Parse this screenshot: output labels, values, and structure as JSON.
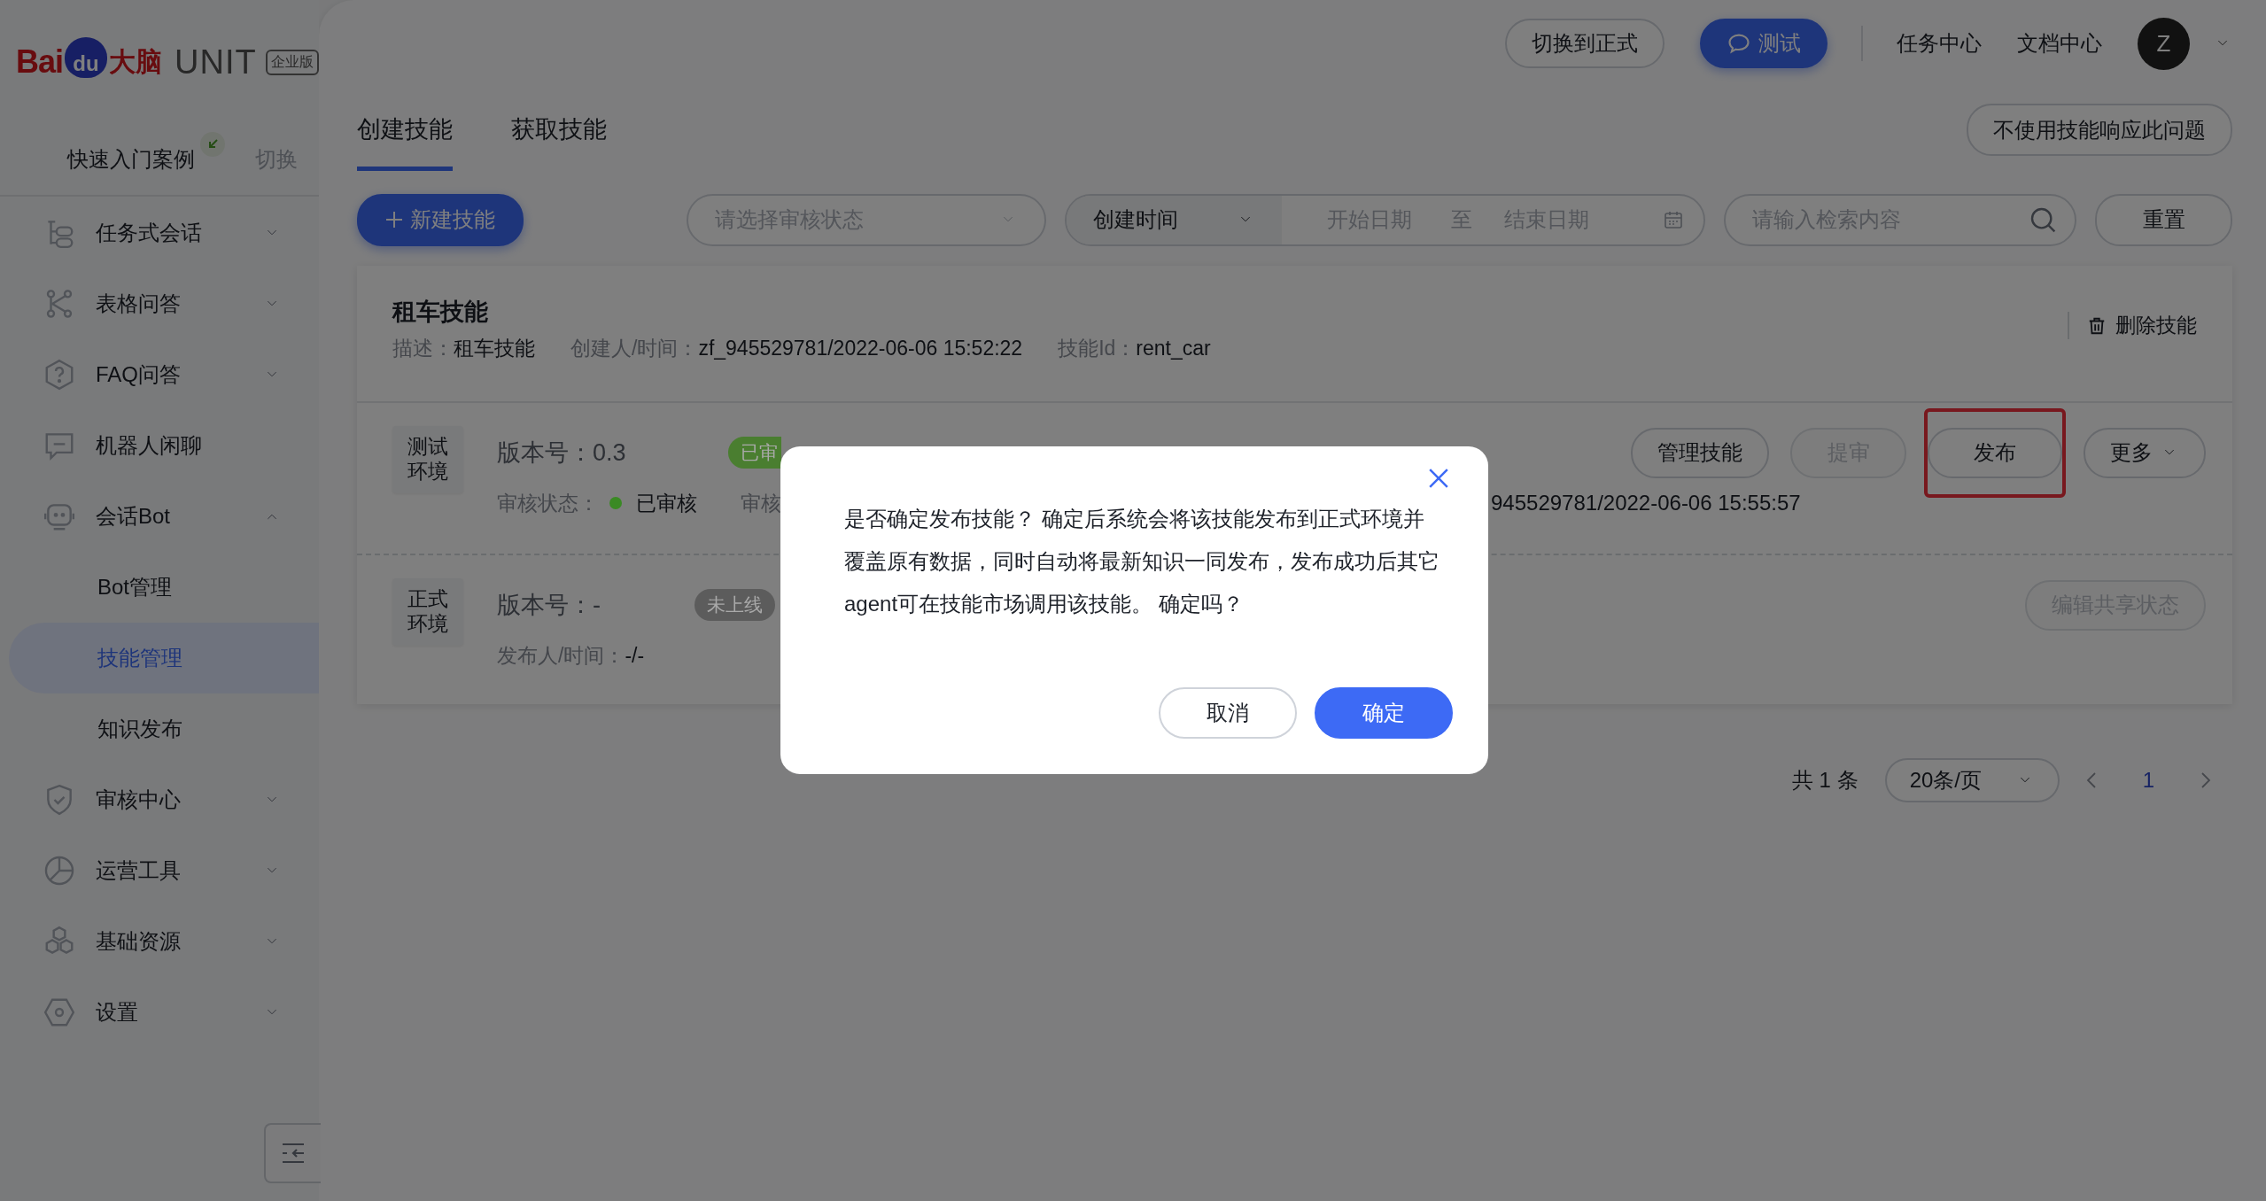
{
  "sidebar": {
    "logo": {
      "brand_left": "Bai",
      "paw": "du",
      "brand_cn": "大脑",
      "product": "UNIT",
      "edition": "企业版"
    },
    "quick_start": {
      "label": "快速入门案例",
      "switch": "切换"
    },
    "menu": [
      {
        "label": "任务式会话",
        "expandable": true,
        "expanded": false
      },
      {
        "label": "表格问答",
        "expandable": true,
        "expanded": false
      },
      {
        "label": "FAQ问答",
        "expandable": true,
        "expanded": false
      },
      {
        "label": "机器人闲聊",
        "expandable": false
      },
      {
        "label": "会话Bot",
        "expandable": true,
        "expanded": true,
        "children": [
          {
            "label": "Bot管理",
            "selected": false
          },
          {
            "label": "技能管理",
            "selected": true
          },
          {
            "label": "知识发布",
            "selected": false
          }
        ]
      },
      {
        "label": "审核中心",
        "expandable": true,
        "expanded": false
      },
      {
        "label": "运营工具",
        "expandable": true,
        "expanded": false
      },
      {
        "label": "基础资源",
        "expandable": true,
        "expanded": false
      },
      {
        "label": "设置",
        "expandable": true,
        "expanded": false
      }
    ]
  },
  "header": {
    "buttons": [
      {
        "label": "切换到正式",
        "kind": "outline"
      },
      {
        "label": "测试",
        "kind": "primary"
      }
    ],
    "links": [
      "任务中心",
      "文档中心"
    ],
    "avatar": "Z"
  },
  "tabs": [
    {
      "label": "创建技能",
      "selected": true
    },
    {
      "label": "获取技能",
      "selected": false
    }
  ],
  "tabs_action": "不使用技能响应此问题",
  "toolbar": {
    "new_button": "新建技能",
    "status_select": {
      "placeholder": "请选择审核状态"
    },
    "date_type": "创建时间",
    "start_date": {
      "placeholder": "开始日期"
    },
    "range_separator": "至",
    "end_date": {
      "placeholder": "结束日期"
    },
    "search": {
      "placeholder": "请输入检索内容"
    },
    "reset": "重置"
  },
  "skill_card": {
    "title": "租车技能",
    "meta": [
      {
        "label": "描述：",
        "value": "租车技能"
      },
      {
        "label": "创建人/时间：",
        "value": "zf_945529781/2022-06-06 15:52:22"
      },
      {
        "label": "技能Id：",
        "value": "rent_car"
      }
    ],
    "delete": "删除技能",
    "environments": [
      {
        "name": "测试环境",
        "version": "版本号：0.3",
        "tag": {
          "text": "已审",
          "color": "#4a7e30"
        },
        "detail": {
          "label": "审核状态：",
          "dot": {
            "color": "#3a8a24"
          },
          "value": "已审核",
          "cut_label": "审核",
          "right_value": "945529781/2022-06-06 15:55:57"
        },
        "actions": [
          {
            "label": "管理技能",
            "kind": "button",
            "disabled": false,
            "highlighted": false
          },
          {
            "label": "提审",
            "kind": "button",
            "disabled": true,
            "highlighted": false
          },
          {
            "label": "发布",
            "kind": "button",
            "disabled": false,
            "highlighted": true
          },
          {
            "label": "更多",
            "kind": "dropdown",
            "disabled": false,
            "highlighted": false
          }
        ]
      },
      {
        "name": "正式环境",
        "version": "版本号：-",
        "tag": {
          "text": "未上线",
          "color": "#5c5c5c"
        },
        "detail": {
          "label": "发布人/时间：",
          "value": "-/-"
        },
        "actions": [
          {
            "label": "编辑共享状态",
            "kind": "button",
            "disabled": true,
            "highlighted": false
          }
        ]
      }
    ]
  },
  "pagination": {
    "total": "共 1 条",
    "page_size": "20条/页",
    "pages": [
      {
        "label": "1",
        "selected": true
      }
    ]
  },
  "dialog": {
    "message": "是否确定发布技能？ 确定后系统会将该技能发布到正式环境并覆盖原有数据，同时自动将最新知识一同发布，发布成功后其它agent可在技能市场调用该技能。 确定吗？",
    "buttons": [
      {
        "label": "取消",
        "kind": "default"
      },
      {
        "label": "确定",
        "kind": "primary"
      }
    ]
  }
}
